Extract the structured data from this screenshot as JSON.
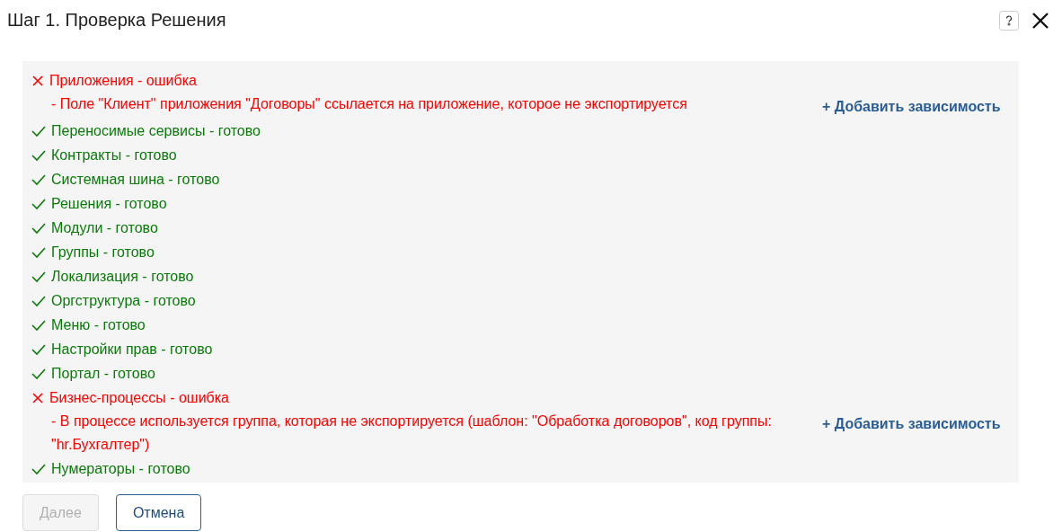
{
  "dialog": {
    "title": "Шаг 1. Проверка Решения"
  },
  "checks": [
    {
      "kind": "error",
      "label": "Приложения - ошибка",
      "detail": "- Поле \"Клиент\" приложения \"Договоры\" ссылается на приложение, которое не экспортируется",
      "action": "+ Добавить зависимость"
    },
    {
      "kind": "ok",
      "label": "Переносимые сервисы - готово"
    },
    {
      "kind": "ok",
      "label": "Контракты - готово"
    },
    {
      "kind": "ok",
      "label": "Системная шина - готово"
    },
    {
      "kind": "ok",
      "label": "Решения - готово"
    },
    {
      "kind": "ok",
      "label": "Модули - готово"
    },
    {
      "kind": "ok",
      "label": "Группы - готово"
    },
    {
      "kind": "ok",
      "label": "Локализация - готово"
    },
    {
      "kind": "ok",
      "label": "Оргструктура - готово"
    },
    {
      "kind": "ok",
      "label": "Меню - готово"
    },
    {
      "kind": "ok",
      "label": "Настройки прав - готово"
    },
    {
      "kind": "ok",
      "label": "Портал - готово"
    },
    {
      "kind": "error",
      "label": "Бизнес-процессы - ошибка",
      "detail": "- В процессе используется группа, которая не экспортируется (шаблон: \"Обработка договоров\", код группы: \"hr.Бухгалтер\")",
      "action": "+ Добавить зависимость"
    },
    {
      "kind": "ok",
      "label": "Нумераторы - готово"
    }
  ],
  "buttons": [
    {
      "label": "Далее",
      "disabled": true
    },
    {
      "label": "Отмена",
      "disabled": false
    }
  ]
}
